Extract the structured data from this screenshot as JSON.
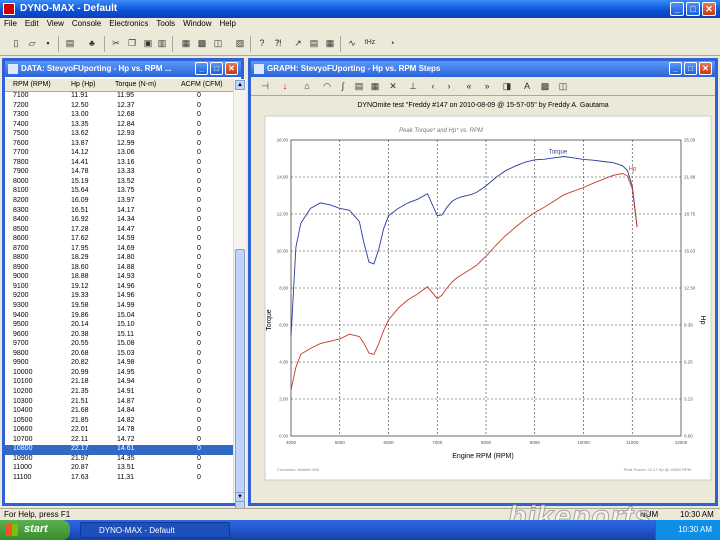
{
  "app": {
    "title": "DYNO-MAX - Default"
  },
  "menu": [
    "File",
    "Edit",
    "View",
    "Console",
    "Electronics",
    "Tools",
    "Window",
    "Help"
  ],
  "toolbar": {
    "icons": [
      "new-icon",
      "open-icon",
      "save-icon",
      "folder-icon",
      "tree-icon",
      "cut-icon",
      "copy-icon",
      "paste-icon",
      "book-icon",
      "print-icon",
      "preview-icon",
      "clipboard-icon",
      "help-icon",
      "pointer-help-icon",
      "chart-icon",
      "table-icon",
      "grid-icon",
      "waveform-icon",
      "gauge-icon"
    ],
    "thz_label": "tHz"
  },
  "data_window": {
    "title": "DATA: StevyoFUporting - Hp vs. RPM ...",
    "columns": [
      "RPM (RPM)",
      "Hp (Hp)",
      "Torque (N-m)",
      "ACFM (CFM)"
    ],
    "rows": [
      [
        "7100",
        "11.91",
        "11.95",
        "0"
      ],
      [
        "7200",
        "12.50",
        "12.37",
        "0"
      ],
      [
        "7300",
        "13.00",
        "12.68",
        "0"
      ],
      [
        "7400",
        "13.35",
        "12.84",
        "0"
      ],
      [
        "7500",
        "13.62",
        "12.93",
        "0"
      ],
      [
        "7600",
        "13.87",
        "12.99",
        "0"
      ],
      [
        "7700",
        "14.12",
        "13.06",
        "0"
      ],
      [
        "7800",
        "14.41",
        "13.16",
        "0"
      ],
      [
        "7900",
        "14.78",
        "13.33",
        "0"
      ],
      [
        "8000",
        "15.19",
        "13.52",
        "0"
      ],
      [
        "8100",
        "15.64",
        "13.75",
        "0"
      ],
      [
        "8200",
        "16.09",
        "13.97",
        "0"
      ],
      [
        "8300",
        "16.51",
        "14.17",
        "0"
      ],
      [
        "8400",
        "16.92",
        "14.34",
        "0"
      ],
      [
        "8500",
        "17.28",
        "14.47",
        "0"
      ],
      [
        "8600",
        "17.62",
        "14.59",
        "0"
      ],
      [
        "8700",
        "17.95",
        "14.69",
        "0"
      ],
      [
        "8800",
        "18.29",
        "14.80",
        "0"
      ],
      [
        "8900",
        "18.60",
        "14.88",
        "0"
      ],
      [
        "9000",
        "18.88",
        "14.93",
        "0"
      ],
      [
        "9100",
        "19.12",
        "14.96",
        "0"
      ],
      [
        "9200",
        "19.33",
        "14.96",
        "0"
      ],
      [
        "9300",
        "19.58",
        "14.99",
        "0"
      ],
      [
        "9400",
        "19.86",
        "15.04",
        "0"
      ],
      [
        "9500",
        "20.14",
        "15.10",
        "0"
      ],
      [
        "9600",
        "20.38",
        "15.11",
        "0"
      ],
      [
        "9700",
        "20.55",
        "15.08",
        "0"
      ],
      [
        "9800",
        "20.68",
        "15.03",
        "0"
      ],
      [
        "9900",
        "20.82",
        "14.98",
        "0"
      ],
      [
        "10000",
        "20.99",
        "14.95",
        "0"
      ],
      [
        "10100",
        "21.18",
        "14.94",
        "0"
      ],
      [
        "10200",
        "21.35",
        "14.91",
        "0"
      ],
      [
        "10300",
        "21.51",
        "14.87",
        "0"
      ],
      [
        "10400",
        "21.68",
        "14.84",
        "0"
      ],
      [
        "10500",
        "21.85",
        "14.82",
        "0"
      ],
      [
        "10600",
        "22.01",
        "14.78",
        "0"
      ],
      [
        "10700",
        "22.11",
        "14.72",
        "0"
      ],
      [
        "10800",
        "22.17",
        "14.61",
        "0"
      ],
      [
        "10900",
        "21.97",
        "14.35",
        "0"
      ],
      [
        "11000",
        "20.87",
        "13.51",
        "0"
      ],
      [
        "11100",
        "17.63",
        "11.31",
        "0"
      ]
    ],
    "selected_row": 37
  },
  "graph_window": {
    "title": "GRAPH: StevyoFUporting - Hp vs. RPM Steps",
    "heading": "DYNOmite test \"Freddy #147 on 2010-08-09 @ 15-57-05\" by Freddy A. Gautama",
    "subtitle": "Peak Torque* and Hp* vs. RPM",
    "footnote_left": "Correction: Mollinit   SAE",
    "footnote_right": "Peak Power: 22.17 Hp @ 10800 RPM",
    "tool_icons": [
      "pin-icon",
      "arrow-icon",
      "shape-icon",
      "rainbow-icon",
      "curve-icon",
      "table-icon",
      "grid-icon",
      "hide-icon",
      "axis-icon",
      "left-icon",
      "right-icon",
      "double-left-icon",
      "double-right-icon",
      "fill-icon",
      "font-icon",
      "print-icon",
      "preview-icon"
    ]
  },
  "chart_data": {
    "type": "line",
    "xlabel": "Engine RPM (RPM)",
    "ylabel": "Torque",
    "y2label": "Hp",
    "xlim": [
      4000,
      12000
    ],
    "ylim": [
      0,
      16
    ],
    "y2lim": [
      0,
      25
    ],
    "x_ticks": [
      "4000",
      "5000",
      "6000",
      "7000",
      "8000",
      "9000",
      "10000",
      "11000",
      "12000"
    ],
    "y_ticks": [
      "0.00",
      "2.00",
      "4.00",
      "6.00",
      "8.00",
      "10.00",
      "12.00",
      "14.00",
      "16.00"
    ],
    "y2_ticks": [
      "0.00",
      "3.13",
      "6.25",
      "9.38",
      "12.50",
      "15.63",
      "18.75",
      "21.88",
      "25.00"
    ],
    "grid": true,
    "series": [
      {
        "name": "Torque",
        "axis": "left",
        "color": "#2a3aa0",
        "x": [
          4000,
          4100,
          4200,
          4400,
          4600,
          4800,
          5000,
          5200,
          5400,
          5500,
          5600,
          5700,
          5800,
          5900,
          6000,
          6200,
          6400,
          6600,
          6800,
          7000,
          7100,
          7200,
          7300,
          7400,
          7500,
          7600,
          7700,
          7800,
          7900,
          8000,
          8200,
          8400,
          8600,
          8800,
          9000,
          9200,
          9400,
          9600,
          9800,
          10000,
          10200,
          10400,
          10600,
          10800,
          10900,
          11000,
          11100
        ],
        "y": [
          5.4,
          10.2,
          11.5,
          12.3,
          12.6,
          12.5,
          12.3,
          12.2,
          11.6,
          10.4,
          9.4,
          9.3,
          10.1,
          11.2,
          11.9,
          12.3,
          12.6,
          12.8,
          13.1,
          11.9,
          11.95,
          12.37,
          12.68,
          12.84,
          12.93,
          12.99,
          13.06,
          13.16,
          13.33,
          13.52,
          13.97,
          14.34,
          14.59,
          14.8,
          14.93,
          14.96,
          15.04,
          15.11,
          15.03,
          14.95,
          14.91,
          14.84,
          14.78,
          14.61,
          14.35,
          13.51,
          11.31
        ]
      },
      {
        "name": "Hp",
        "axis": "right",
        "color": "#c83a2a",
        "x": [
          4000,
          4100,
          4200,
          4400,
          4600,
          4800,
          5000,
          5200,
          5400,
          5500,
          5600,
          5700,
          5800,
          5900,
          6000,
          6200,
          6400,
          6600,
          6800,
          7000,
          7100,
          7200,
          7300,
          7400,
          7500,
          7600,
          7700,
          7800,
          7900,
          8000,
          8200,
          8400,
          8600,
          8800,
          9000,
          9200,
          9400,
          9600,
          9800,
          10000,
          10200,
          10400,
          10600,
          10800,
          10900,
          11000,
          11100
        ],
        "y": [
          3.9,
          5.8,
          6.9,
          7.4,
          7.8,
          8.0,
          8.2,
          8.6,
          8.4,
          7.8,
          7.0,
          6.9,
          7.8,
          8.9,
          9.8,
          10.8,
          11.5,
          12.0,
          12.6,
          11.6,
          11.91,
          12.5,
          13.0,
          13.35,
          13.62,
          13.87,
          14.12,
          14.41,
          14.78,
          15.19,
          16.09,
          16.92,
          17.62,
          18.29,
          18.88,
          19.33,
          19.86,
          20.38,
          20.68,
          20.99,
          21.35,
          21.68,
          22.01,
          22.17,
          21.97,
          20.87,
          17.63
        ]
      }
    ]
  },
  "status": {
    "left": "For Help, press F1",
    "num": "NUM",
    "time": "10:30 AM"
  },
  "taskbar": {
    "start": "start",
    "task": "DYNO-MAX - Default",
    "clock": "10:30 AM"
  },
  "watermark": "bikeports"
}
